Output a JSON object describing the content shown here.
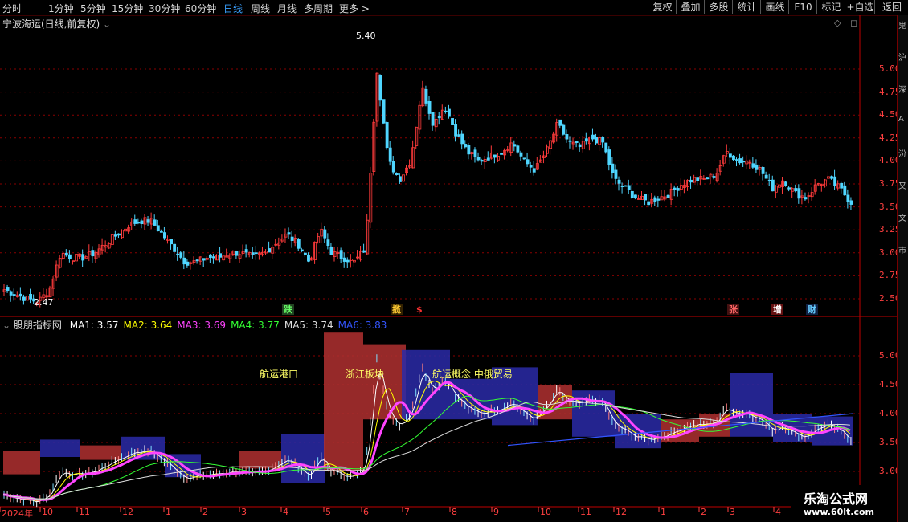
{
  "toolbar": {
    "timeframes": [
      "分时",
      "1分钟",
      "5分钟",
      "15分钟",
      "30分钟",
      "60分钟",
      "日线",
      "周线",
      "月线",
      "多周期",
      "更多 >"
    ],
    "active": "日线",
    "buttons": [
      "复权",
      "叠加",
      "多股",
      "统计",
      "画线",
      "F10",
      "标记",
      "+自选",
      "返回"
    ]
  },
  "right_strip_text": [
    "鬼",
    "沪",
    "深",
    "A",
    "汾",
    "又",
    "文",
    "市"
  ],
  "price_panel": {
    "title": "宁波海运(日线,前复权)",
    "high_label": "5.40",
    "low_label": "2.47",
    "ticks": [
      "5.00",
      "4.75",
      "4.50",
      "4.25",
      "4.00",
      "3.75",
      "3.50",
      "3.25",
      "3.00",
      "2.75",
      "2.50"
    ],
    "signals": [
      {
        "text": "跌",
        "color": "#66ff66",
        "bg": "#224422"
      },
      {
        "text": "揽",
        "color": "#ffcc33",
        "bg": "#332200"
      },
      {
        "text": "$",
        "color": "#ff3333",
        "bg": "#000000"
      },
      {
        "text": "张",
        "color": "#ff6666",
        "bg": "#441111"
      },
      {
        "text": "增",
        "color": "#ffffff",
        "bg": "#661111"
      },
      {
        "text": "财",
        "color": "#66ccff",
        "bg": "#112244"
      }
    ]
  },
  "indicator_panel": {
    "name": "股朋指标网",
    "ma_items": [
      {
        "label": "MA1: 3.57",
        "color": "#ffffff"
      },
      {
        "label": "MA2: 3.64",
        "color": "#ffff00"
      },
      {
        "label": "MA3: 3.69",
        "color": "#ff44ff"
      },
      {
        "label": "MA4: 3.77",
        "color": "#33ff33"
      },
      {
        "label": "MA5: 3.74",
        "color": "#dddddd"
      },
      {
        "label": "MA6: 3.83",
        "color": "#3355ff"
      }
    ],
    "annotations": [
      "航运港口",
      "浙江板块",
      "航运概念 中俄贸易"
    ],
    "ticks": [
      "5.00",
      "4.50",
      "4.00",
      "3.50",
      "3.00"
    ]
  },
  "x_axis": {
    "months": [
      "2024年",
      "10",
      "11",
      "12",
      "1",
      "2",
      "3",
      "4",
      "5",
      "6",
      "7",
      "8",
      "9",
      "10",
      "11",
      "12",
      "1",
      "2",
      "3",
      "4"
    ]
  },
  "watermark": {
    "line1": "乐淘公式网",
    "line2": "www.60lt.com"
  },
  "colors": {
    "up": "#ff3b3b",
    "down": "#4fd6ff",
    "grid": "#8a0000",
    "axis": "#ff4040"
  },
  "chart_data": {
    "type": "candlestick",
    "approx_close": [
      2.6,
      2.55,
      2.5,
      2.47,
      2.6,
      3.0,
      2.95,
      2.95,
      3.0,
      3.1,
      3.2,
      3.3,
      3.35,
      3.35,
      3.2,
      3.05,
      2.9,
      2.9,
      2.95,
      2.95,
      3.0,
      3.0,
      2.95,
      3.0,
      3.1,
      3.2,
      3.1,
      2.9,
      3.25,
      3.0,
      2.95,
      2.9,
      3.05,
      5.0,
      4.0,
      3.8,
      4.0,
      4.8,
      4.4,
      4.6,
      4.3,
      4.1,
      4.0,
      4.05,
      4.1,
      4.2,
      4.0,
      3.9,
      4.1,
      4.4,
      4.2,
      4.15,
      4.25,
      4.2,
      3.8,
      3.7,
      3.6,
      3.55,
      3.6,
      3.65,
      3.75,
      3.8,
      3.8,
      3.85,
      4.1,
      4.0,
      4.0,
      3.9,
      3.7,
      3.8,
      3.65,
      3.6,
      3.75,
      3.8,
      3.7,
      3.55
    ]
  }
}
